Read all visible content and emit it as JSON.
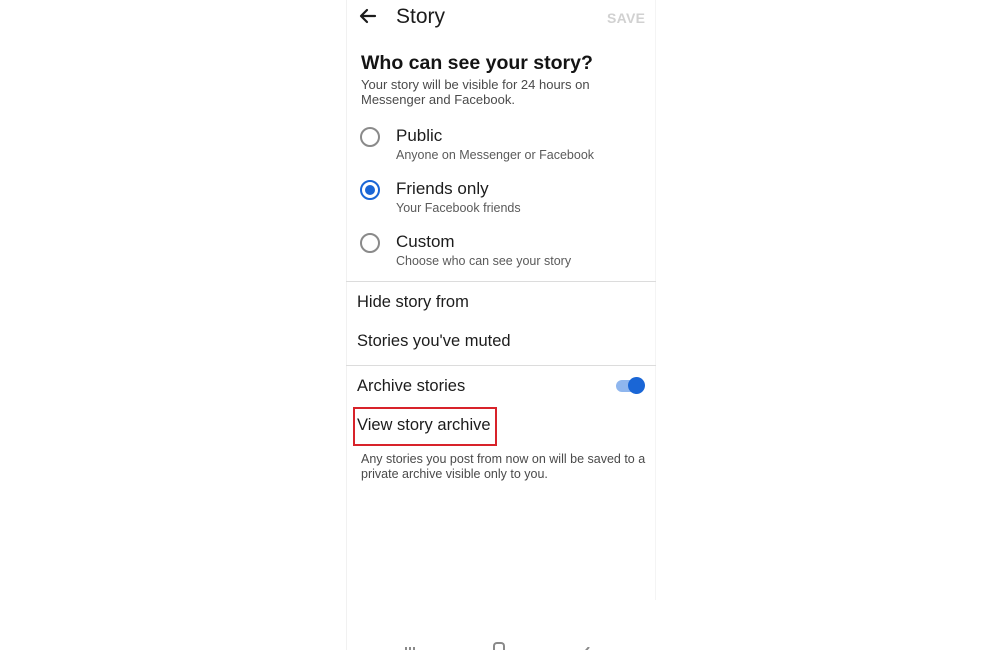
{
  "header": {
    "title": "Story",
    "save_label": "SAVE"
  },
  "audience": {
    "heading": "Who can see your story?",
    "description": "Your story will be visible for 24 hours on Messenger and Facebook.",
    "options": [
      {
        "label": "Public",
        "description": "Anyone on Messenger or Facebook",
        "selected": false
      },
      {
        "label": "Friends only",
        "description": "Your Facebook friends",
        "selected": true
      },
      {
        "label": "Custom",
        "description": "Choose who can see your story",
        "selected": false
      }
    ]
  },
  "menu": {
    "hide_story_from": "Hide story from",
    "stories_muted": "Stories you've muted"
  },
  "archive": {
    "toggle_label": "Archive stories",
    "toggle_on": true,
    "view_archive_label": "View story archive",
    "note": "Any stories you post from now on will be saved to a private archive visible only to you."
  },
  "colors": {
    "accent": "#1a66d6",
    "highlight_box": "#d8232a",
    "save_disabled": "#d1d1d1"
  },
  "icons": {
    "back": "back-arrow-icon",
    "nav_recent": "recent-apps-icon",
    "nav_home": "home-icon",
    "nav_back": "nav-back-icon"
  }
}
